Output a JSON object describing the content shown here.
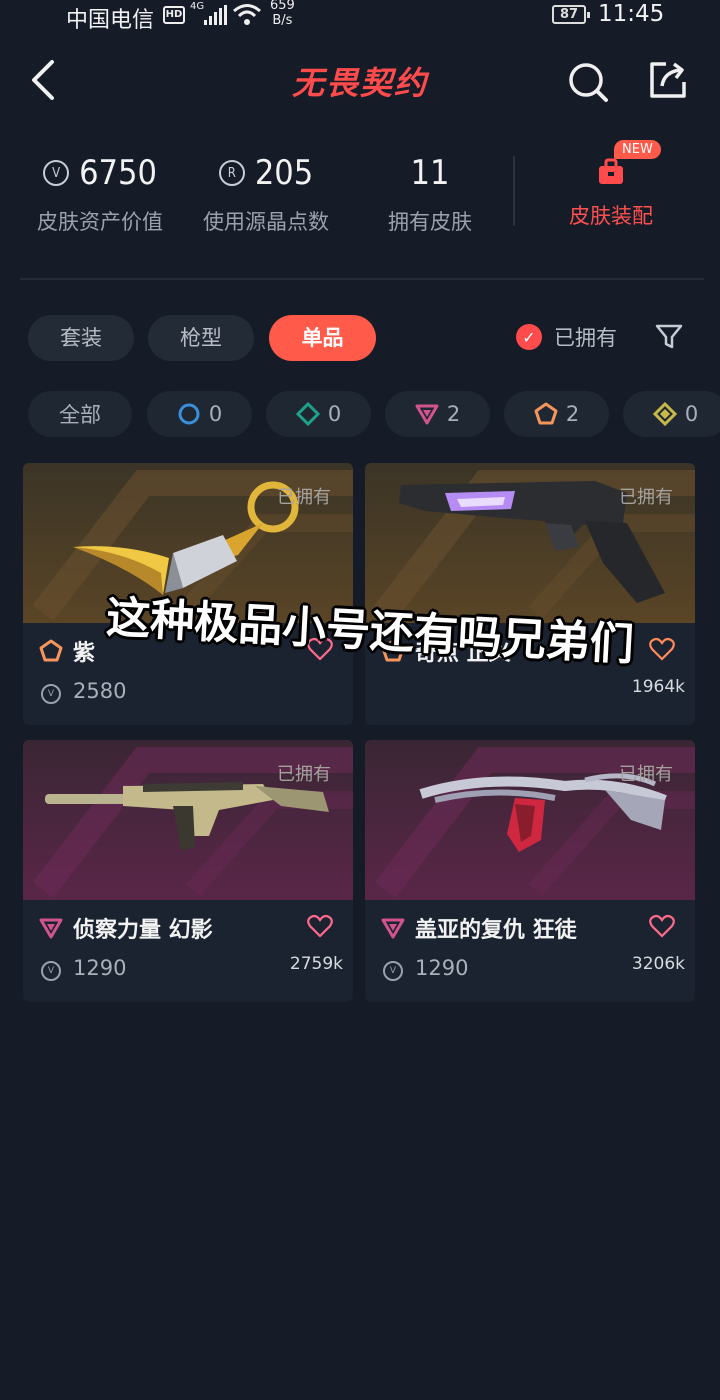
{
  "status_bar": {
    "carrier": "中国电信",
    "hd": "HD",
    "network": "4G",
    "speed_value": "659",
    "speed_unit": "B/s",
    "battery": "87",
    "time": "11:45"
  },
  "header": {
    "title": "无畏契约",
    "back_icon": "chevron-left-icon",
    "search_icon": "search-icon",
    "share_icon": "share-icon"
  },
  "stats": [
    {
      "value": "6750",
      "label": "皮肤资产价值",
      "icon": "vp-coin-icon"
    },
    {
      "value": "205",
      "label": "使用源晶点数",
      "icon": "radianite-coin-icon"
    },
    {
      "value": "11",
      "label": "拥有皮肤"
    }
  ],
  "equip": {
    "label": "皮肤装配",
    "badge": "NEW",
    "icon": "toolbox-icon"
  },
  "tabs": [
    {
      "label": "套装",
      "active": false
    },
    {
      "label": "枪型",
      "active": false
    },
    {
      "label": "单品",
      "active": true
    }
  ],
  "owned_filter": {
    "label": "已拥有",
    "checked": true
  },
  "chips": [
    {
      "label": "全部"
    },
    {
      "count": "0",
      "tier": "select",
      "color": "#3a8fd8"
    },
    {
      "count": "0",
      "tier": "deluxe",
      "color": "#1ea38a"
    },
    {
      "count": "2",
      "tier": "premium",
      "color": "#d1548e"
    },
    {
      "count": "2",
      "tier": "exclusive",
      "color": "#f5955b"
    },
    {
      "count": "0",
      "tier": "ultra",
      "color": "#c8b84a"
    }
  ],
  "cards": [
    {
      "name": "紫",
      "price": "2580",
      "likes": "",
      "owned": "已拥有",
      "tier_color": "#f5955b"
    },
    {
      "name": "奇点 正义",
      "price": "",
      "likes": "1964k",
      "owned": "已拥有",
      "tier_color": "#f5955b"
    },
    {
      "name": "侦察力量 幻影",
      "price": "1290",
      "likes": "2759k",
      "owned": "已拥有",
      "tier_color": "#d1548e"
    },
    {
      "name": "盖亚的复仇 狂徒",
      "price": "1290",
      "likes": "3206k",
      "owned": "已拥有",
      "tier_color": "#d1548e"
    }
  ],
  "overlay_caption": "这种极品小号还有吗兄弟们",
  "colors": {
    "accent": "#ff5a4a",
    "background": "#151c27",
    "card": "#1b2330"
  }
}
